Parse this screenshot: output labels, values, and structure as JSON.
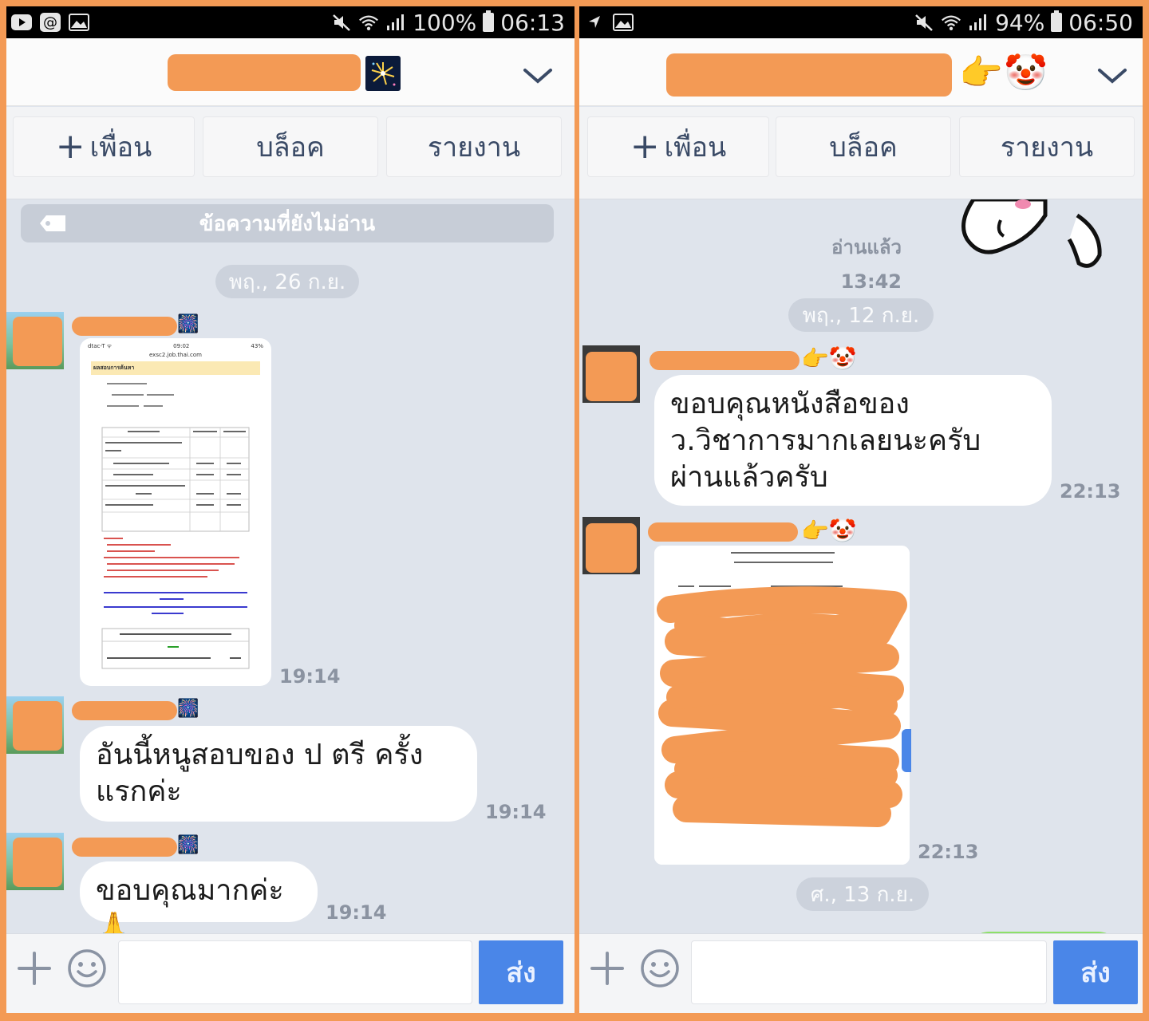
{
  "colors": {
    "frame_border": "#f39a55",
    "redaction": "#f39a55",
    "chat_bg": "#dfe4ec",
    "send_button": "#4a86e8",
    "action_text": "#3a4a66",
    "timestamp": "#8b93a1"
  },
  "left": {
    "status": {
      "icons_left": [
        "youtube-icon",
        "at-icon",
        "gallery-icon"
      ],
      "icons_right": [
        "mute-icon",
        "wifi-icon",
        "signal-icon"
      ],
      "battery_percent": "100%",
      "time": "06:13"
    },
    "header": {
      "avatar_emoji": "🎆"
    },
    "actions": {
      "add_friend": "เพื่อน",
      "block": "บล็อค",
      "report": "รายงาน"
    },
    "unread_label": "ข้อความที่ยังไม่อ่าน",
    "date_pill": "พฤ., 26 ก.ย.",
    "messages": [
      {
        "type": "image",
        "time": "19:14",
        "sender_emoji": "🎆",
        "doc": {
          "carrier": "dtac-T ᯤ",
          "clock": "09:02",
          "battery": "43%",
          "url": "exsc2.job.thai.com",
          "heading": "ผลสอบการค้นหา"
        }
      },
      {
        "type": "text",
        "text": "อันนี้หนูสอบของ ป ตรี ครั้ง\nแรกค่ะ",
        "time": "19:14",
        "sender_emoji": "🎆"
      },
      {
        "type": "text",
        "text": "ขอบคุณมากค่ะ 🙏",
        "time": "19:14",
        "sender_emoji": "🎆"
      }
    ],
    "input": {
      "send": "ส่ง"
    }
  },
  "right": {
    "status": {
      "icons_left": [
        "navigation-icon",
        "gallery-icon"
      ],
      "icons_right": [
        "mute-icon",
        "wifi-icon",
        "signal-icon"
      ],
      "battery_percent": "94%",
      "time": "06:50"
    },
    "header": {
      "emoji_point": "👉",
      "emoji_clown": "🤡"
    },
    "actions": {
      "add_friend": "เพื่อน",
      "block": "บล็อค",
      "report": "รายงาน"
    },
    "read_label": "อ่านแล้ว",
    "read_time": "13:42",
    "date_pill_1": "พฤ., 12 ก.ย.",
    "date_pill_2": "ศ., 13 ก.ย.",
    "messages": [
      {
        "type": "text",
        "text": "ขอบคุณหนังสือของ\nว.วิชาการมากเลยนะครับ\nผ่านแล้วครับ",
        "time": "22:13",
        "sender_emoji": "👉🤡"
      },
      {
        "type": "image",
        "time": "22:13",
        "sender_emoji": "👉🤡"
      }
    ],
    "input": {
      "send": "ส่ง"
    }
  }
}
